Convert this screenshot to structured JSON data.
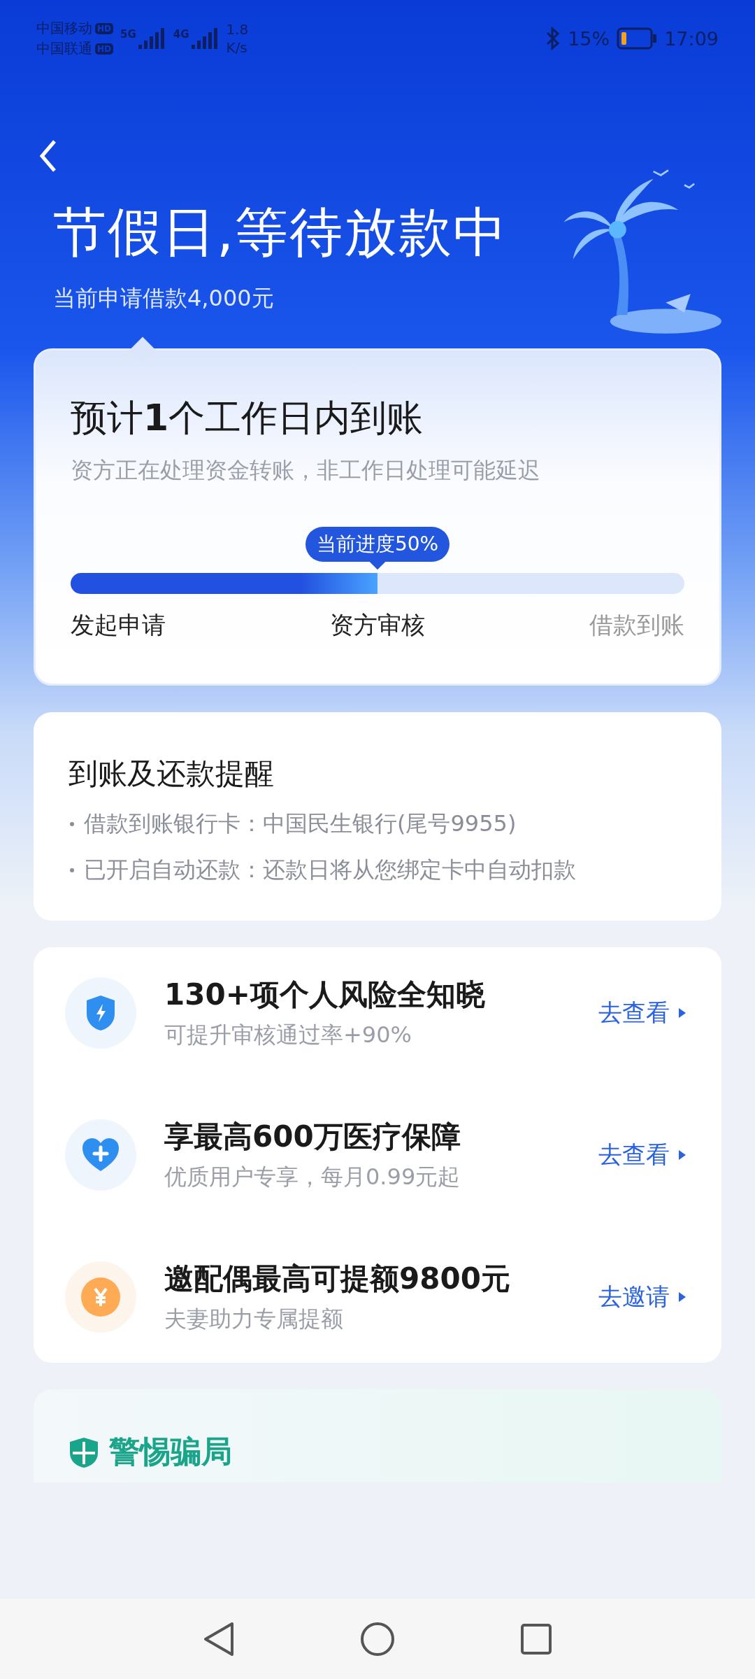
{
  "status_bar": {
    "carriers": [
      {
        "name": "中国移动",
        "badge": "HD"
      },
      {
        "name": "中国联通",
        "badge": "HD"
      }
    ],
    "networks": [
      "5G",
      "4G"
    ],
    "speed": [
      "1.8",
      "K/s"
    ],
    "battery": "15%",
    "time": "17:09"
  },
  "header": {
    "title": "节假日,等待放款中",
    "subtitle": "当前申请借款4,000元"
  },
  "progress_card": {
    "title": "预计**1**个工作日内到账",
    "note": "资方正在处理资金转账，非工作日处理可能延迟",
    "badge": "当前进度50%",
    "level": 0.5,
    "steps": [
      {
        "label": "发起申请",
        "done": true
      },
      {
        "label": "资方审核",
        "done": true
      },
      {
        "label": "借款到账",
        "done": false
      }
    ]
  },
  "reminder_card": {
    "title": "到账及还款提醒",
    "items": [
      "借款到账银行卡：中国民生银行(尾号9955)",
      "已开启自动还款：还款日将从您绑定卡中自动扣款"
    ]
  },
  "offers": [
    {
      "kind": "shield",
      "title": "130+项个人风险全知晓",
      "subtitle": "可提升审核通过率+90%",
      "action": "去查看"
    },
    {
      "kind": "heart",
      "title": "享最高600万医疗保障",
      "subtitle": "优质用户专享，每月0.99元起",
      "action": "去查看"
    },
    {
      "kind": "coin",
      "title": "邀配偶最高可提额9800元",
      "subtitle": "夫妻助力专属提额",
      "action": "去邀请"
    }
  ],
  "warning_card": {
    "title": "警惕骗局"
  }
}
